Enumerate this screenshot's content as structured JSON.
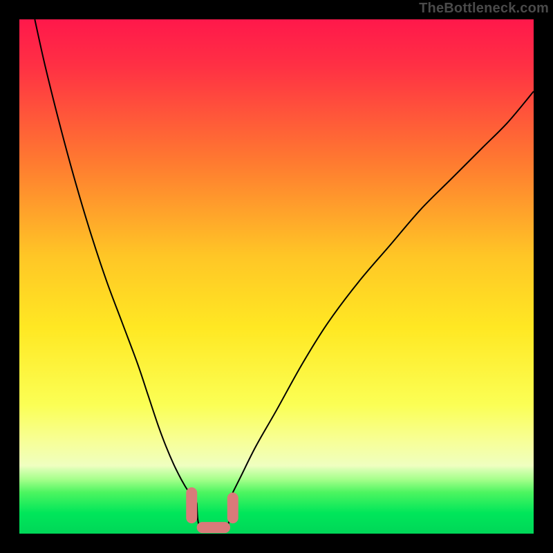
{
  "watermark": "TheBottleneck.com",
  "domain": "Chart",
  "chart_data": {
    "type": "line",
    "title": "",
    "xlabel": "",
    "ylabel": "",
    "xlim": [
      0,
      100
    ],
    "ylim": [
      0,
      100
    ],
    "colors": {
      "gradient_top": "#ff2047",
      "gradient_mid_upper": "#ff8f2b",
      "gradient_mid": "#ffe22a",
      "gradient_lower": "#f9ff8c",
      "gradient_band": "#e8ffa8",
      "gradient_bottom": "#00e65a",
      "curve": "#000000",
      "marker_fill": "#d97a7a",
      "marker_stroke": "#c46060",
      "outer_frame": "#000000"
    },
    "gradient_stops_percent": [
      {
        "p": 0,
        "c": "#ff184b"
      },
      {
        "p": 9,
        "c": "#ff3044"
      },
      {
        "p": 28,
        "c": "#ff7b30"
      },
      {
        "p": 46,
        "c": "#ffc626"
      },
      {
        "p": 60,
        "c": "#ffe823"
      },
      {
        "p": 75,
        "c": "#fbff55"
      },
      {
        "p": 82,
        "c": "#f7ff97"
      },
      {
        "p": 86.8,
        "c": "#efffc0"
      },
      {
        "p": 87.6,
        "c": "#d5ffb0"
      },
      {
        "p": 89.5,
        "c": "#a4ff8a"
      },
      {
        "p": 92,
        "c": "#4cf560"
      },
      {
        "p": 96,
        "c": "#00e65a"
      },
      {
        "p": 100,
        "c": "#00d758"
      }
    ],
    "series": [
      {
        "name": "left_branch",
        "comment": "bottleneck% rising sharply to the left of the optimum; y is percent bottleneck, x is percent along horizontal axis",
        "x": [
          3,
          5,
          8,
          11,
          14,
          17,
          20,
          23,
          25,
          27,
          28.5,
          30,
          31.5,
          33,
          34.5
        ],
        "values": [
          100,
          91,
          79,
          68,
          58,
          49,
          41,
          33,
          27,
          21,
          17,
          13.5,
          10.5,
          8,
          6
        ]
      },
      {
        "name": "right_branch",
        "comment": "bottleneck% rising to the right of the optimum up to ~86% at x=100",
        "x": [
          41,
          43,
          46,
          50,
          55,
          60,
          66,
          72,
          78,
          84,
          90,
          95,
          100
        ],
        "values": [
          7,
          11,
          17,
          24,
          33,
          41,
          49,
          56,
          63,
          69,
          75,
          80,
          86
        ]
      }
    ],
    "optimum_band": {
      "comment": "near-zero bottleneck region along the x axis (percent)",
      "x_start": 34,
      "x_end": 41,
      "y": 0
    },
    "markers": {
      "comment": "highlighted salmon rounded segments near the minimum, y is percent above baseline",
      "items": [
        {
          "kind": "vertical",
          "x": 33.5,
          "y_bottom": 2,
          "y_top": 9
        },
        {
          "kind": "horizontal",
          "x_start": 34.5,
          "x_end": 41,
          "y": 1.2
        },
        {
          "kind": "vertical",
          "x": 41.5,
          "y_bottom": 2,
          "y_top": 8
        }
      ]
    }
  }
}
